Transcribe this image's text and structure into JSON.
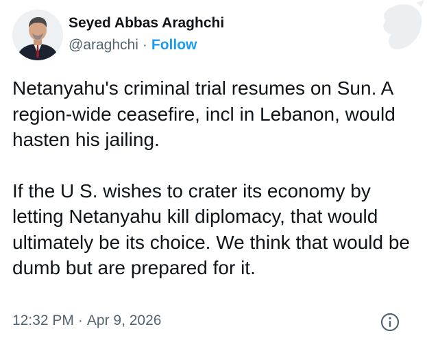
{
  "author": {
    "name": "Seyed Abbas Araghchi",
    "handle": "@araghchi",
    "separator": "·",
    "follow_label": "Follow"
  },
  "tweet": {
    "paragraphs": [
      "Netanyahu's criminal trial resumes on Sun. A region-wide ceasefire, incl in Lebanon, would hasten his jailing.",
      "If the U S. wishes to crater its economy by letting Netanyahu kill diplomacy, that would ultimately be its choice. We think that would be dumb but are prepared for it."
    ]
  },
  "footer": {
    "time": "12:32 PM",
    "separator": "·",
    "date": "Apr 9, 2026"
  },
  "icons": {
    "info": "info-icon",
    "watermark": "bird-watermark-icon"
  },
  "colors": {
    "accent": "#1d9bf0",
    "text": "#0f1419",
    "muted": "#536471"
  }
}
